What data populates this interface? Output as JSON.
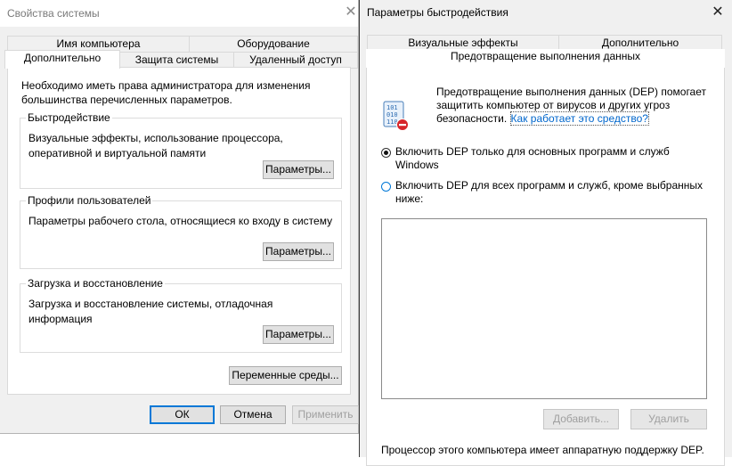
{
  "system_properties": {
    "title": "Свойства системы",
    "close_glyph": "✕",
    "tabs_row1": [
      "Имя компьютера",
      "Оборудование"
    ],
    "tabs_row2": [
      "Дополнительно",
      "Защита системы",
      "Удаленный доступ"
    ],
    "active_tab": "Дополнительно",
    "admin_note": "Необходимо иметь права администратора для изменения большинства перечисленных параметров.",
    "performance": {
      "legend": "Быстродействие",
      "description": "Визуальные эффекты, использование процессора, оперативной и виртуальной памяти",
      "button": "Параметры..."
    },
    "user_profiles": {
      "legend": "Профили пользователей",
      "description": "Параметры рабочего стола, относящиеся ко входу в систему",
      "button": "Параметры..."
    },
    "startup_recovery": {
      "legend": "Загрузка и восстановление",
      "description": "Загрузка и восстановление системы, отладочная информация",
      "button": "Параметры..."
    },
    "env_button": "Переменные среды...",
    "ok": "ОК",
    "cancel": "Отмена",
    "apply": "Применить"
  },
  "performance_options": {
    "title": "Параметры быстродействия",
    "close_glyph": "✕",
    "tabs_row1": [
      "Визуальные эффекты",
      "Дополнительно"
    ],
    "active_tab": "Предотвращение выполнения данных",
    "dep_icon": "dep-shield-icon",
    "dep_intro": "Предотвращение выполнения данных (DEP) помогает защитить компьютер от вирусов и других угроз безопасности.",
    "dep_link": "Как работает это средство?",
    "option1": "Включить DEP только для основных программ и служб Windows",
    "option2": "Включить DEP для всех программ и служб, кроме выбранных ниже:",
    "selected_option": 1,
    "add_button": "Добавить...",
    "remove_button": "Удалить",
    "hardware_note": "Процессор этого компьютера имеет аппаратную поддержку DEP."
  }
}
